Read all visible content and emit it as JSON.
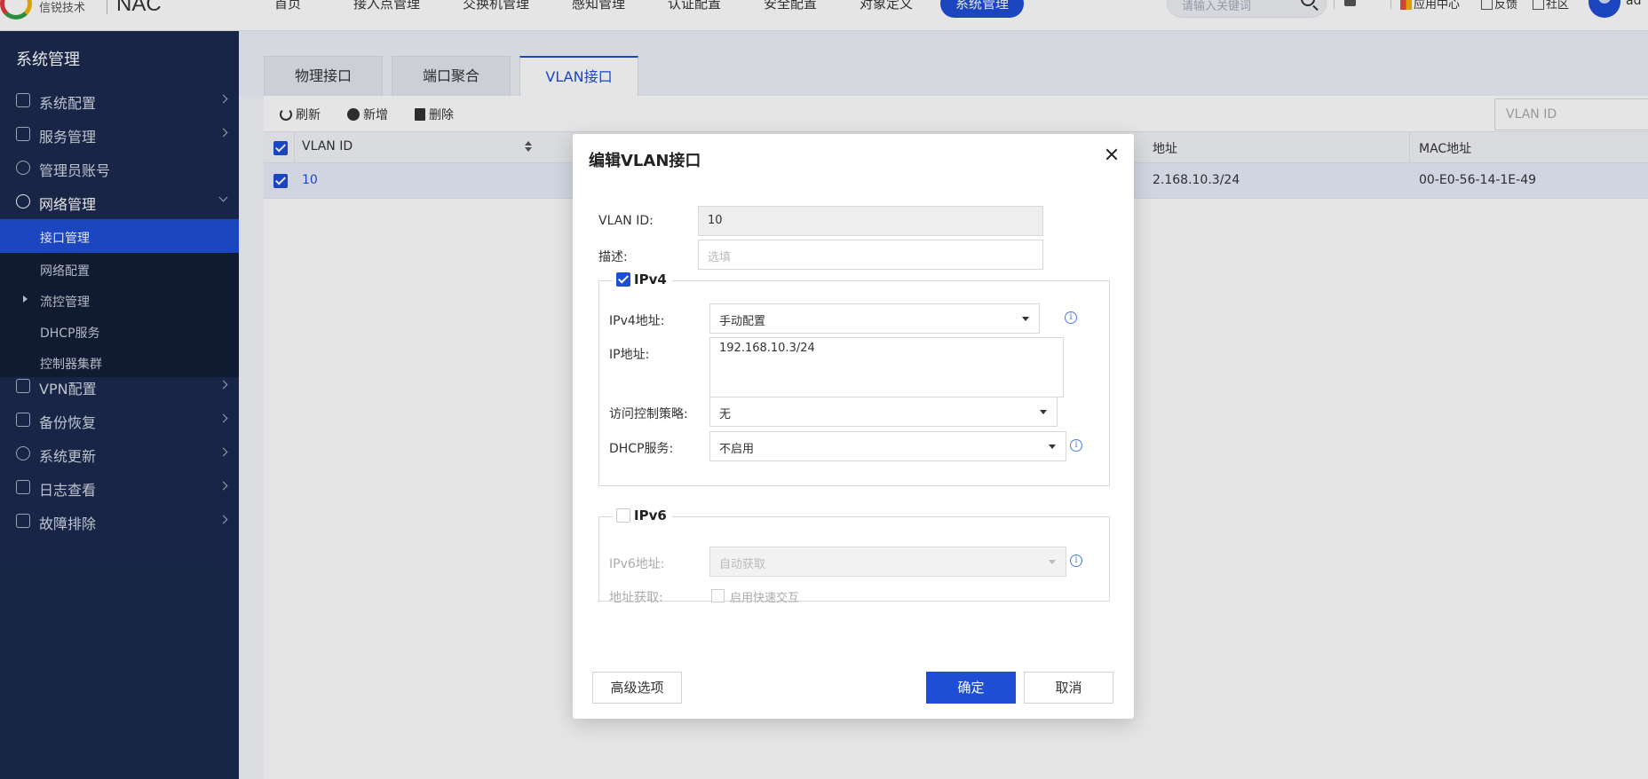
{
  "topbar": {
    "logo_sub": "信锐技术",
    "product": "NAC",
    "nav": [
      "首页",
      "接入点管理",
      "交换机管理",
      "感知管理",
      "认证配置",
      "安全配置",
      "对象定义",
      "系统管理"
    ],
    "search_placeholder": "请输入关键词",
    "app_center": "应用中心",
    "feedback": "反馈",
    "community": "社区",
    "user": "ad"
  },
  "sidebar": {
    "title": "系统管理",
    "items": [
      "系统配置",
      "服务管理",
      "管理员账号",
      "网络管理"
    ],
    "sub_items": [
      "接口管理",
      "网络配置",
      "流控管理",
      "DHCP服务",
      "控制器集群"
    ],
    "items_after": [
      "VPN配置",
      "备份恢复",
      "系统更新",
      "日志查看",
      "故障排除"
    ]
  },
  "tabs": [
    "物理接口",
    "端口聚合",
    "VLAN接口"
  ],
  "toolbar": {
    "refresh": "刷新",
    "add": "新增",
    "delete": "删除",
    "search_placeholder": "VLAN ID"
  },
  "table": {
    "columns": [
      "VLAN ID",
      "地址",
      "MAC地址"
    ],
    "rows": [
      {
        "vlan_id": "10",
        "ip": "2.168.10.3/24",
        "mac": "00-E0-56-14-1E-49"
      }
    ]
  },
  "modal": {
    "title": "编辑VLAN接口",
    "vlan_id_label": "VLAN ID:",
    "vlan_id_value": "10",
    "desc_label": "描述:",
    "desc_placeholder": "选填",
    "ipv4": {
      "legend": "IPv4",
      "checked": true,
      "addr_label": "IPv4地址:",
      "addr_value": "手动配置",
      "ip_label": "IP地址:",
      "ip_value": "192.168.10.3/24",
      "acl_label": "访问控制策略:",
      "acl_value": "无",
      "dhcp_label": "DHCP服务:",
      "dhcp_value": "不启用"
    },
    "ipv6": {
      "legend": "IPv6",
      "checked": false,
      "addr_label": "IPv6地址:",
      "addr_value": "自动获取",
      "acquire_label": "地址获取:",
      "fast_label": "启用快速交互"
    },
    "advanced": "高级选项",
    "ok": "确定",
    "cancel": "取消"
  },
  "colors": {
    "primary": "#1f4ed6",
    "sidebar_bg": "#1b2a4e",
    "info_icon": "#4a7de8"
  }
}
